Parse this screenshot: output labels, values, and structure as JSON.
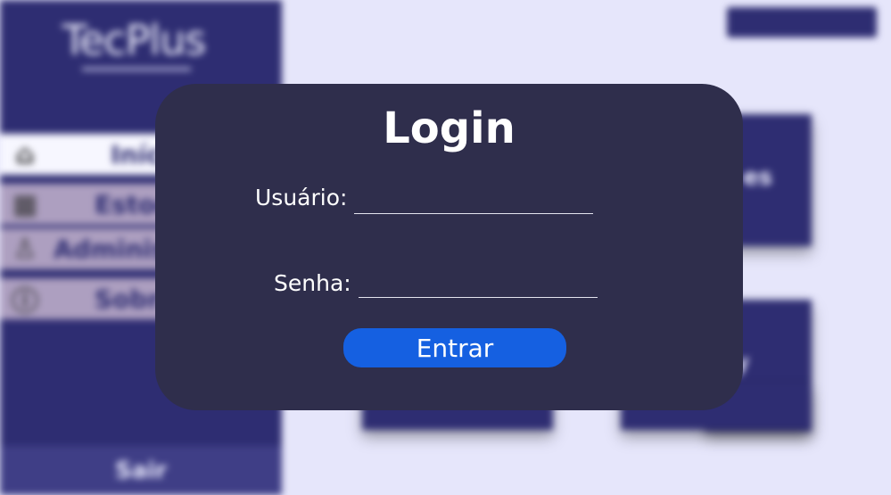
{
  "app": {
    "brand": "TecPlus"
  },
  "sidebar": {
    "items": [
      {
        "label": "Início",
        "icon": "home-icon"
      },
      {
        "label": "Estoque",
        "icon": "stock-icon"
      },
      {
        "label": "Administração",
        "icon": "admin-icon"
      },
      {
        "label": "Sobre",
        "icon": "info-icon"
      }
    ],
    "logout_label": "Sair"
  },
  "main": {
    "tile_labels": [
      "es",
      "y"
    ]
  },
  "login": {
    "title": "Login",
    "user_label": "Usuário:",
    "user_value": "",
    "password_label": "Senha:",
    "password_value": "",
    "submit_label": "Entrar"
  },
  "colors": {
    "sidebar": "#2e2d72",
    "modal": "#2f2e4c",
    "primary_button": "#1560e1",
    "background": "#e6e6fb",
    "nav_active": "#f7f7ff",
    "nav_inactive": "#ad9fc0"
  }
}
